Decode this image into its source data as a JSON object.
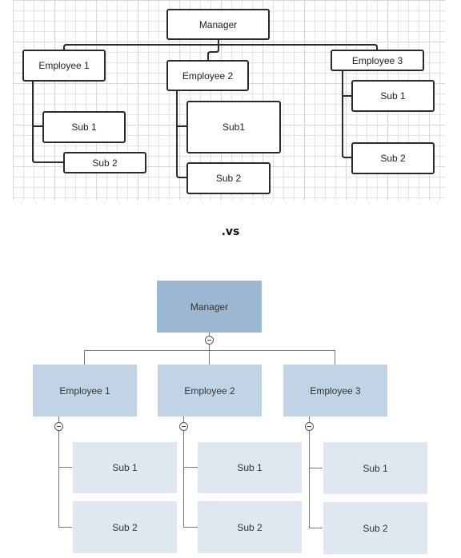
{
  "separator_label": ".vs",
  "top_chart": {
    "style": "grid-canvas-rounded-outline",
    "manager": "Manager",
    "employees": [
      {
        "label": "Employee 1",
        "subs": [
          "Sub 1",
          "Sub 2"
        ]
      },
      {
        "label": "Employee 2",
        "subs": [
          "Sub1",
          "Sub 2"
        ]
      },
      {
        "label": "Employee 3",
        "subs": [
          "Sub 1",
          "Sub 2"
        ]
      }
    ]
  },
  "bottom_chart": {
    "style": "filled-blue-boxes",
    "colors": {
      "manager": "#9bb7d1",
      "employee": "#c0d4e6",
      "sub": "#dfe7f0",
      "connector": "#777777"
    },
    "collapse_icon": "minus-circle-icon",
    "manager": "Manager",
    "employees": [
      {
        "label": "Employee 1",
        "subs": [
          "Sub 1",
          "Sub 2"
        ]
      },
      {
        "label": "Employee 2",
        "subs": [
          "Sub 1",
          "Sub 2"
        ]
      },
      {
        "label": "Employee 3",
        "subs": [
          "Sub 1",
          "Sub 2"
        ]
      }
    ]
  }
}
